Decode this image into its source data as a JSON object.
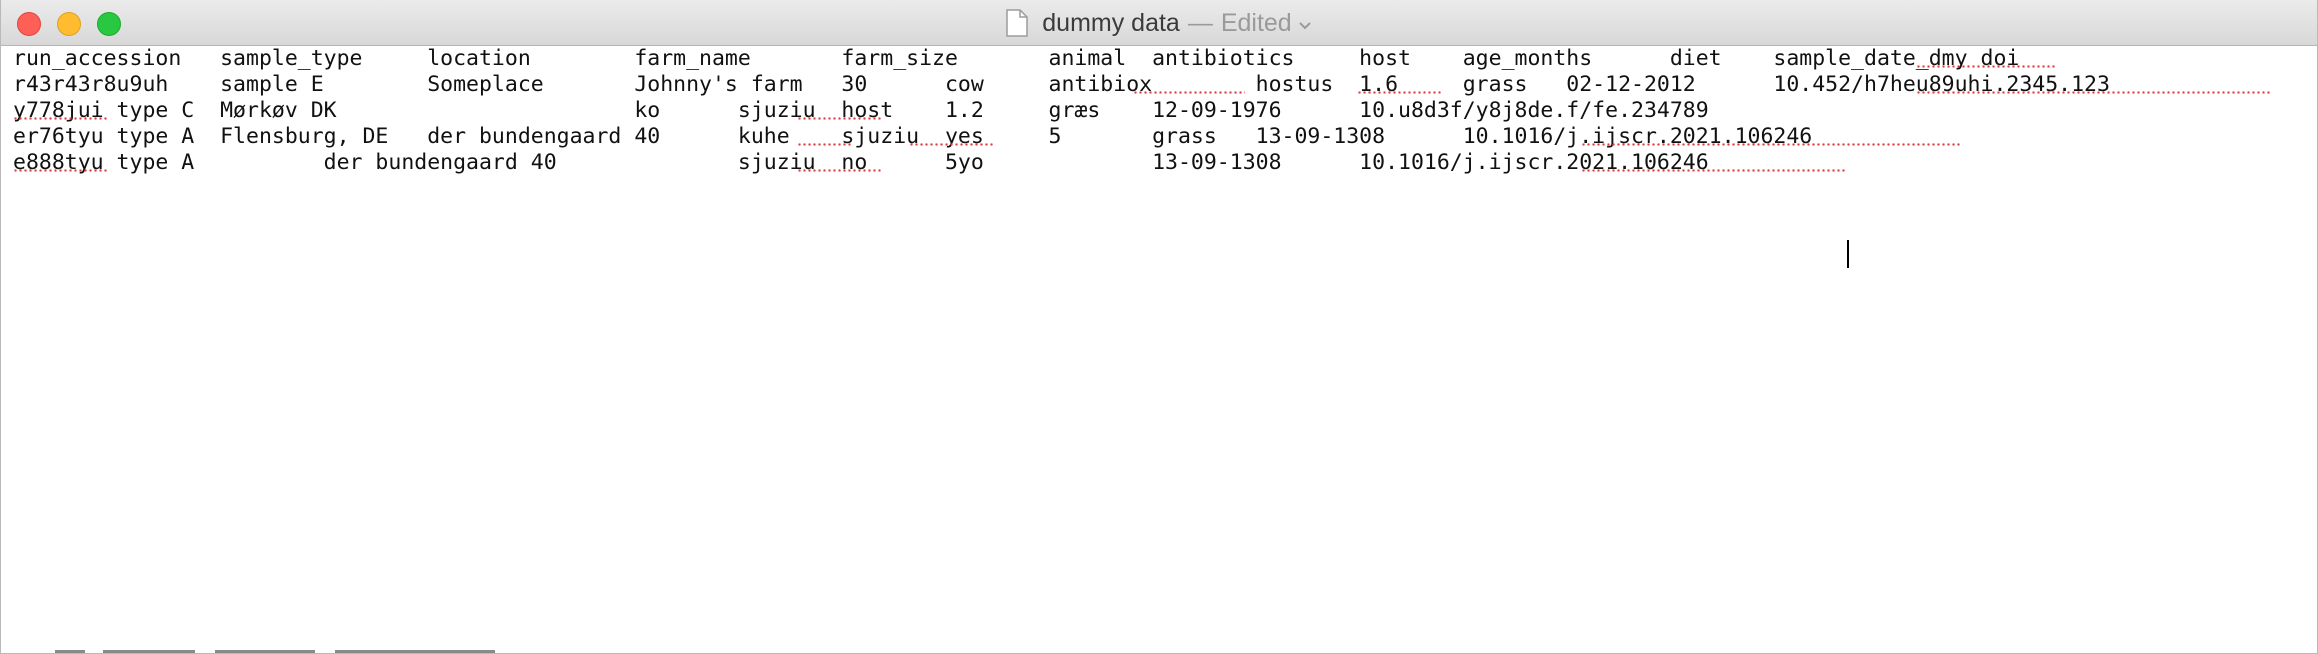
{
  "window": {
    "document_name": "dummy data",
    "separator": "—",
    "edited_label": "Edited"
  },
  "document": {
    "lines": [
      "run_accession   sample_type     location        farm_name       farm_size       animal  antibiotics     host    age_months      diet    sample_date_dmy doi",
      "r43r43r8u9uh    sample E        Someplace       Johnny's farm   30      cow     antibiox        hostus  1.6     grass   02-12-2012      10.452/h7heu89uhi.2345.123",
      "y778jui type C  Mørkøv DK                       ko      sjuziu  host    1.2     græs    12-09-1976      10.u8d3f/y8j8de.f/fe.234789",
      "er76tyu type A  Flensburg, DE   der bundengaard 40      kuhe    sjuziu  yes     5       grass   13-09-1308      10.1016/j.ijscr.2021.106246",
      "e888tyu type A          der bundengaard 40              sjuziu  no      5yo             13-09-1308      10.1016/j.ijscr.2021.106246"
    ]
  },
  "colors": {
    "close": "#fe5f57",
    "minimize": "#febc2e",
    "zoom": "#28c840",
    "spellcheck": "#e0393e"
  }
}
